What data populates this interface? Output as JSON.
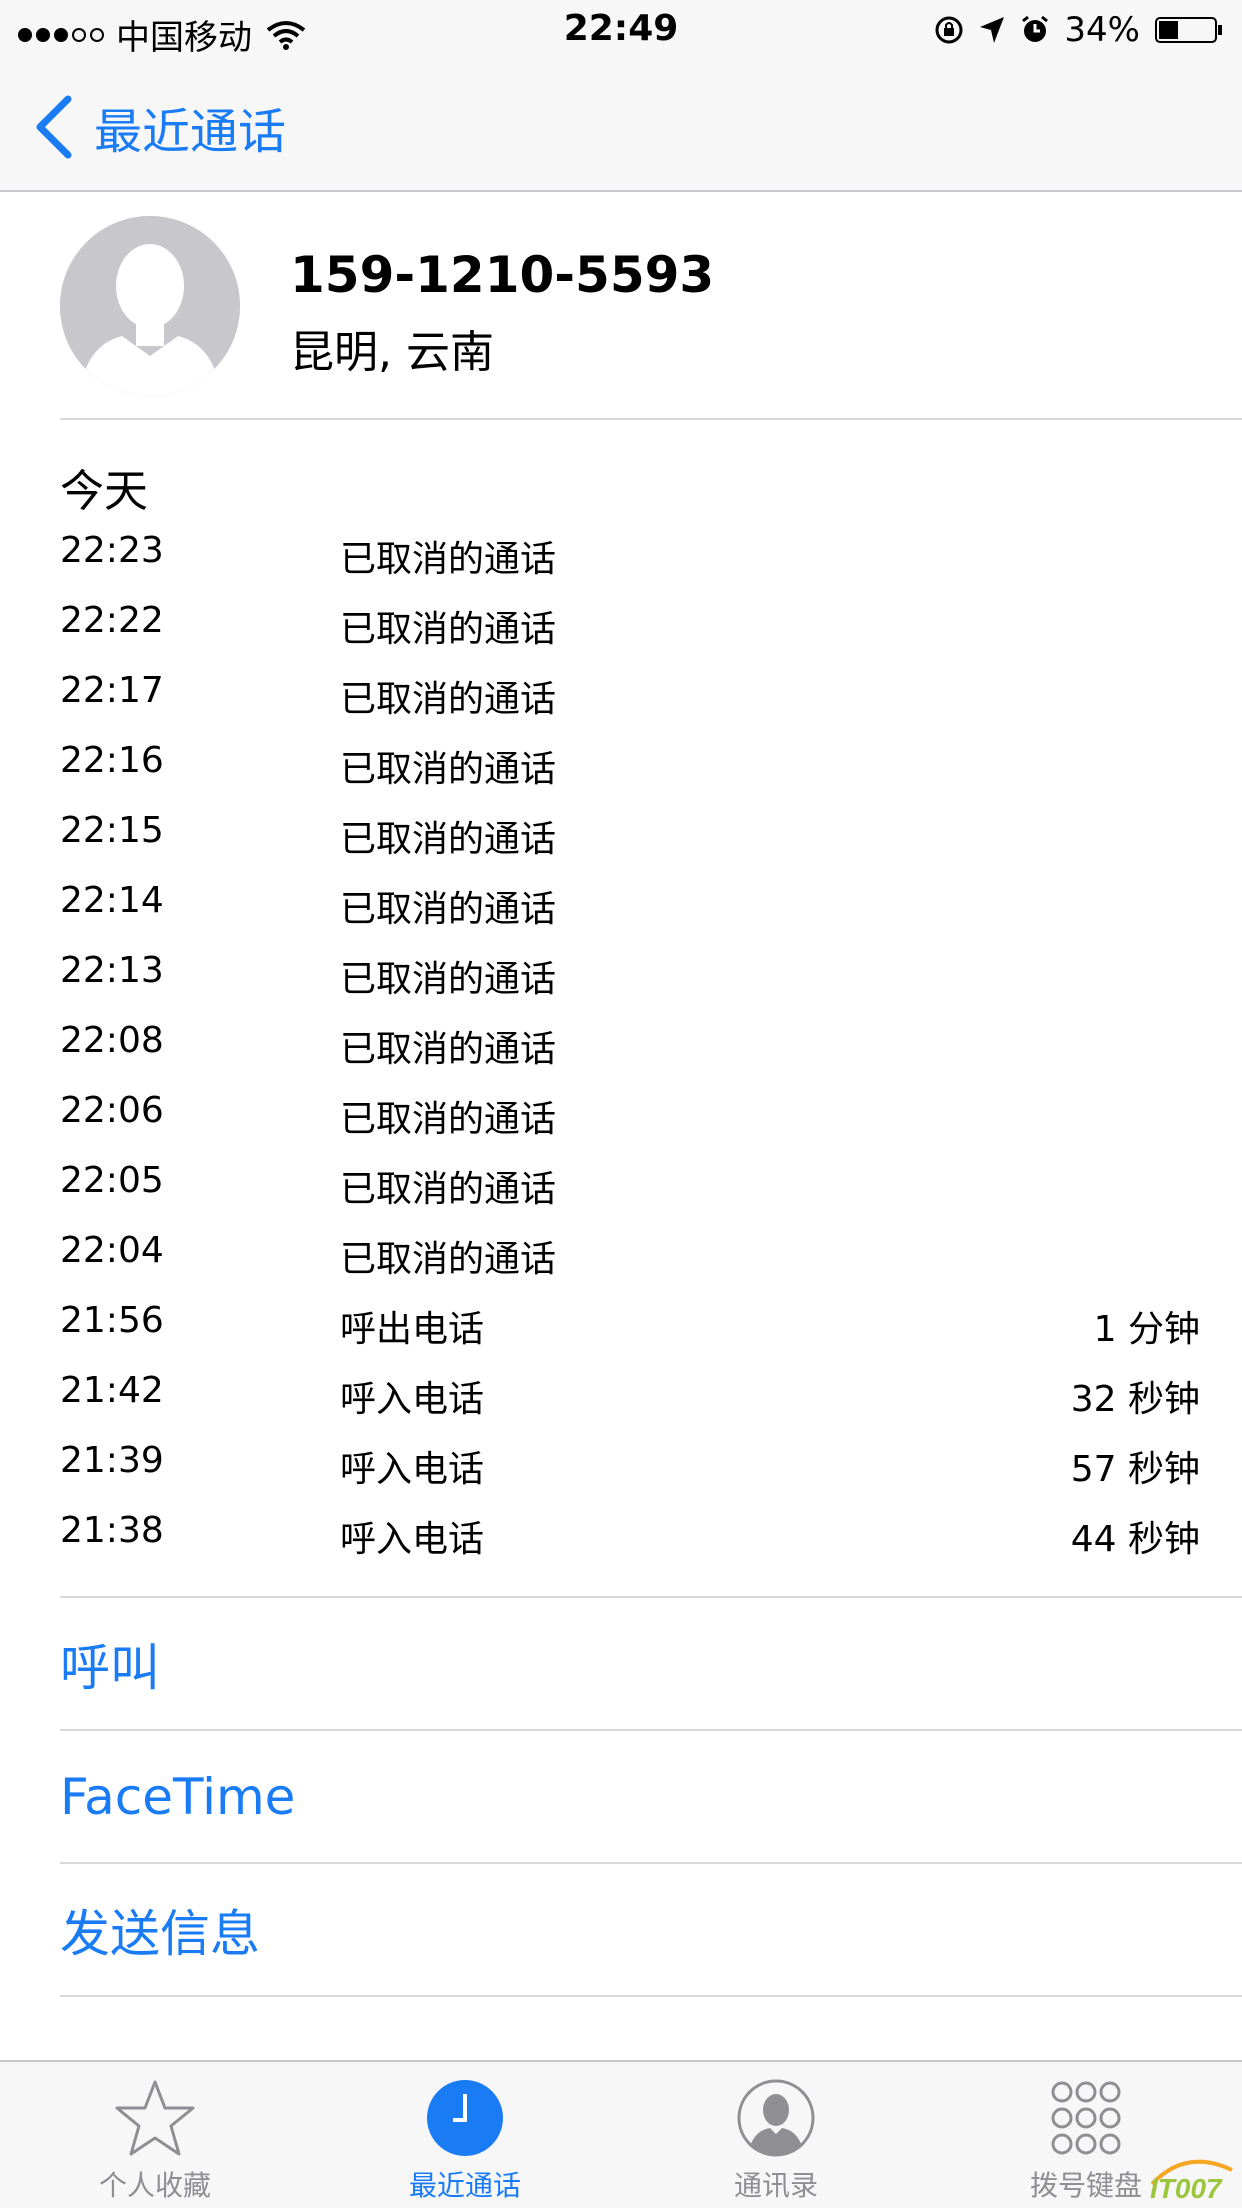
{
  "status_bar": {
    "carrier": "中国移动",
    "time": "22:49",
    "battery": "34%"
  },
  "nav": {
    "back_label": "最近通话"
  },
  "contact": {
    "number": "159-1210-5593",
    "location": "昆明, 云南"
  },
  "day_label": "今天",
  "calls": [
    {
      "time": "22:23",
      "type": "已取消的通话",
      "duration": ""
    },
    {
      "time": "22:22",
      "type": "已取消的通话",
      "duration": ""
    },
    {
      "time": "22:17",
      "type": "已取消的通话",
      "duration": ""
    },
    {
      "time": "22:16",
      "type": "已取消的通话",
      "duration": ""
    },
    {
      "time": "22:15",
      "type": "已取消的通话",
      "duration": ""
    },
    {
      "time": "22:14",
      "type": "已取消的通话",
      "duration": ""
    },
    {
      "time": "22:13",
      "type": "已取消的通话",
      "duration": ""
    },
    {
      "time": "22:08",
      "type": "已取消的通话",
      "duration": ""
    },
    {
      "time": "22:06",
      "type": "已取消的通话",
      "duration": ""
    },
    {
      "time": "22:05",
      "type": "已取消的通话",
      "duration": ""
    },
    {
      "time": "22:04",
      "type": "已取消的通话",
      "duration": ""
    },
    {
      "time": "21:56",
      "type": "呼出电话",
      "duration": "1 分钟"
    },
    {
      "time": "21:42",
      "type": "呼入电话",
      "duration": "32 秒钟"
    },
    {
      "time": "21:39",
      "type": "呼入电话",
      "duration": "57 秒钟"
    },
    {
      "time": "21:38",
      "type": "呼入电话",
      "duration": "44 秒钟"
    }
  ],
  "actions": {
    "call": "呼叫",
    "facetime": "FaceTime",
    "message": "发送信息"
  },
  "tabs": {
    "favorites": "个人收藏",
    "recents": "最近通话",
    "contacts": "通讯录",
    "keypad": "拨号键盘"
  },
  "colors": {
    "accent": "#1a7cf5",
    "inactive": "#8e8e93"
  }
}
